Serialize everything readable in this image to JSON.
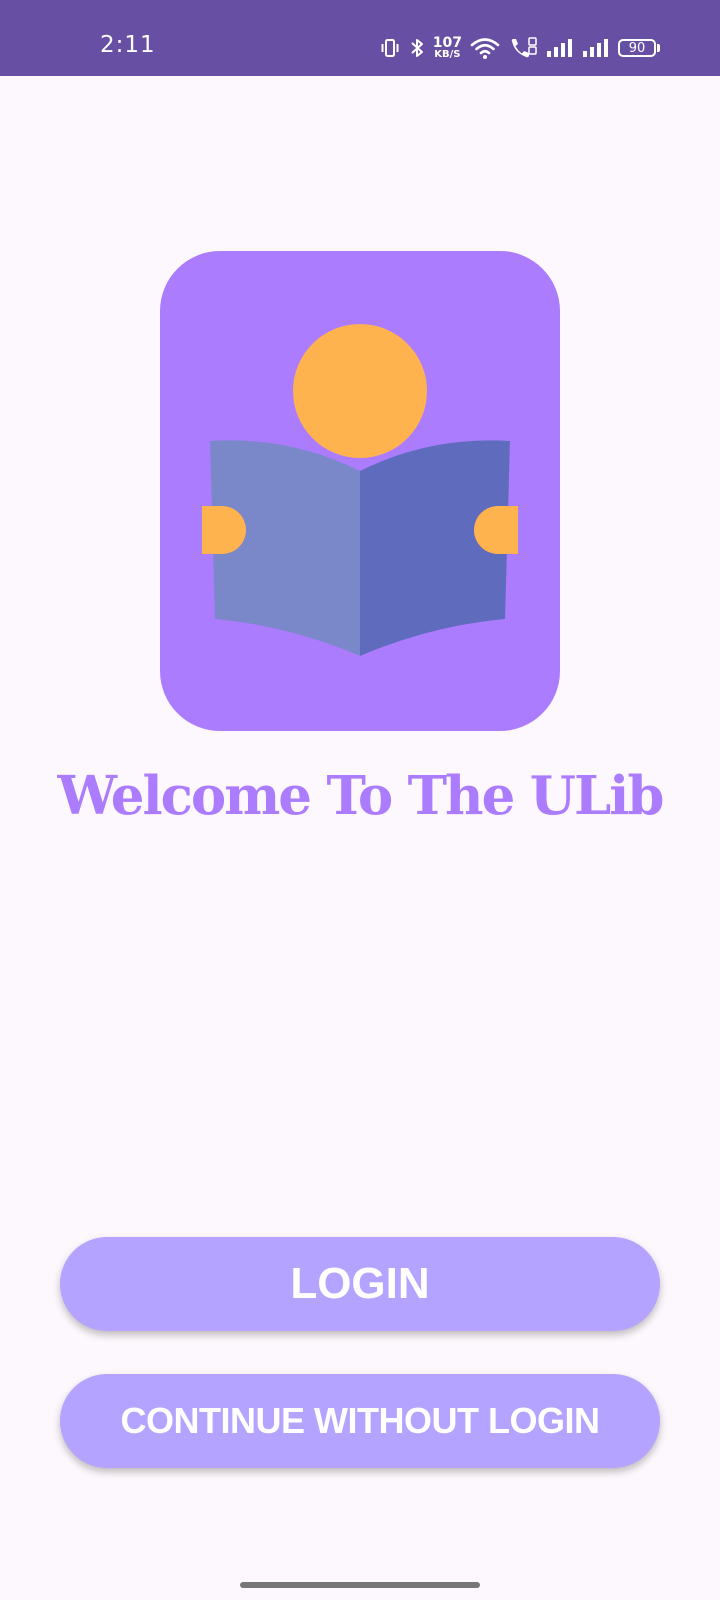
{
  "status_bar": {
    "time": "2:11",
    "net_speed_value": "107",
    "net_speed_unit": "KB/S",
    "battery_level": "90",
    "background_color": "#6750a4",
    "icons": [
      "vibrate-icon",
      "bluetooth-icon",
      "wifi-icon",
      "volte-call-icon",
      "signal-icon",
      "signal-icon",
      "battery-icon"
    ]
  },
  "logo": {
    "icon": "reading-person-icon",
    "colors": {
      "background": "#ac7cfe",
      "head": "#ffb34e",
      "book_left": "#7a87c9",
      "book_right": "#5f6bbd",
      "hands": "#ffb34e"
    }
  },
  "welcome": {
    "title": "Welcome To The ULib",
    "color": "#ac7cfe"
  },
  "buttons": {
    "login_label": "LOGIN",
    "continue_label": "CONTINUE WITHOUT LOGIN",
    "color": "#b4a3ff"
  }
}
